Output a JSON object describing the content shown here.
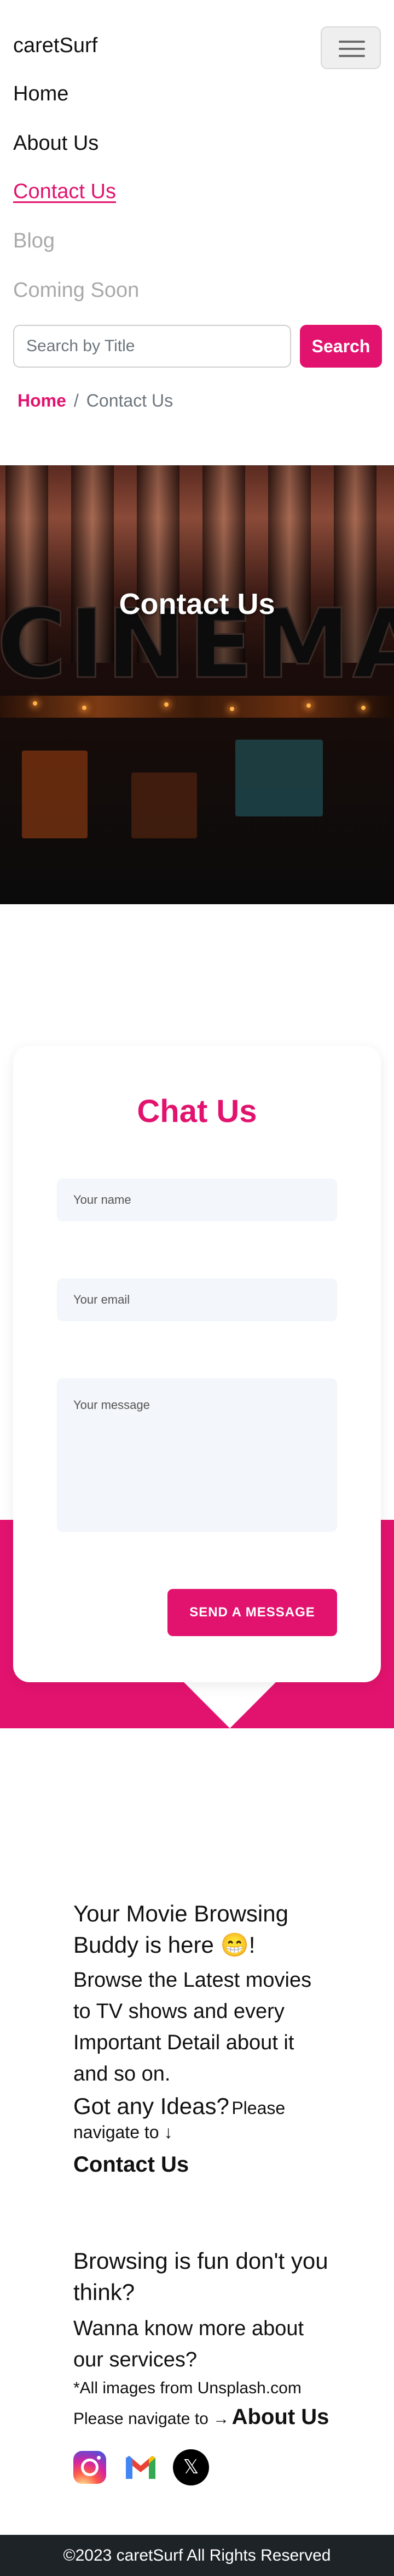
{
  "navbar": {
    "brand": "caretSurf",
    "links": [
      {
        "label": "Home"
      },
      {
        "label": "About Us"
      },
      {
        "label": "Contact Us"
      },
      {
        "label": "Blog"
      },
      {
        "label": "Coming Soon"
      }
    ],
    "search": {
      "placeholder": "Search by Title",
      "button_label": "Search"
    }
  },
  "breadcrumb": {
    "items": [
      "Home",
      "Contact Us"
    ],
    "separator": "/"
  },
  "hero": {
    "title": "Contact Us",
    "sign_text": "CINEMA"
  },
  "chat": {
    "title": "Chat Us",
    "name_placeholder": "Your name",
    "email_placeholder": "Your email",
    "message_placeholder": "Your message",
    "submit_label": "SEND A MESSAGE"
  },
  "info": {
    "heading1": "Your Movie Browsing Buddy is here 😁!",
    "desc1": "Browse the Latest movies to TV shows and every Important Detail about it and so on.",
    "ideas_label": "Got any Ideas?",
    "ideas_nav": "Please navigate to ↓",
    "contact_link": "Contact Us",
    "heading2": "Browsing is fun don't you think?",
    "desc2": "Wanna know more about our services?",
    "credit": "*All images from Unsplash.com",
    "about_nav": "Please navigate to →",
    "about_link": "About Us"
  },
  "socials": {
    "instagram": "instagram-icon",
    "gmail": "gmail-icon",
    "x": "x-icon",
    "x_glyph": "𝕏"
  },
  "footer": {
    "copyright": "©2023 caretSurf All Rights Reserved"
  },
  "colors": {
    "accent": "#e2136e",
    "footer_bg": "#1e2328"
  }
}
